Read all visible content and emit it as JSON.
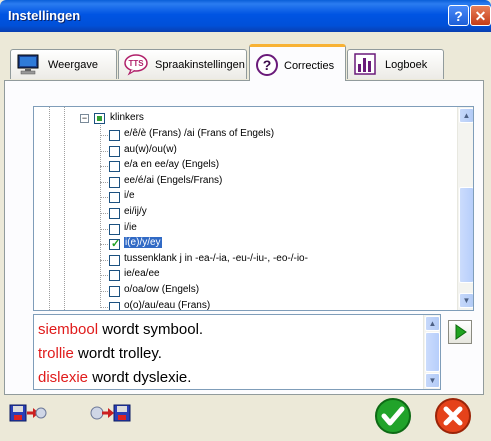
{
  "window": {
    "title": "Instellingen"
  },
  "tabs": [
    {
      "label": "Weergave",
      "icon": "monitor-icon"
    },
    {
      "label": "Spraakinstellingen",
      "icon": "tts-icon",
      "icon_text": "TTS"
    },
    {
      "label": "Correcties",
      "icon": "question-icon",
      "active": true
    },
    {
      "label": "Logboek",
      "icon": "logbook-chart-icon"
    }
  ],
  "tree": {
    "parent": {
      "label": "klinkers",
      "expanded": true
    },
    "items": [
      {
        "label": "e/ê/è (Frans) /ai (Frans of Engels)",
        "checked": false
      },
      {
        "label": "au(w)/ou(w)",
        "checked": false
      },
      {
        "label": "e/a en ee/ay (Engels)",
        "checked": false
      },
      {
        "label": "ee/é/ai (Engels/Frans)",
        "checked": false
      },
      {
        "label": "i/e",
        "checked": false
      },
      {
        "label": "ei/ij/y",
        "checked": false
      },
      {
        "label": "i/ie",
        "checked": false
      },
      {
        "label": "i(e)/y/ey",
        "checked": true,
        "selected": true
      },
      {
        "label": "tussenklank j in -ea-/-ia, -eu-/-iu-, -eo-/-io-",
        "checked": false
      },
      {
        "label": "ie/ea/ee",
        "checked": false
      },
      {
        "label": "o/oa/ow (Engels)",
        "checked": false
      },
      {
        "label": "o(o)/au/eau (Frans)",
        "checked": false
      }
    ]
  },
  "preview": {
    "lines": [
      {
        "wrong": "siembool",
        "rest": " wordt symbool."
      },
      {
        "wrong": "trollie",
        "rest": " wordt trolley."
      },
      {
        "wrong": "dislexie",
        "rest": " wordt dyslexie."
      }
    ]
  },
  "colors": {
    "wrong_word": "#e01b1b",
    "selection": "#316ac5",
    "title_bar": "#0054e3"
  }
}
